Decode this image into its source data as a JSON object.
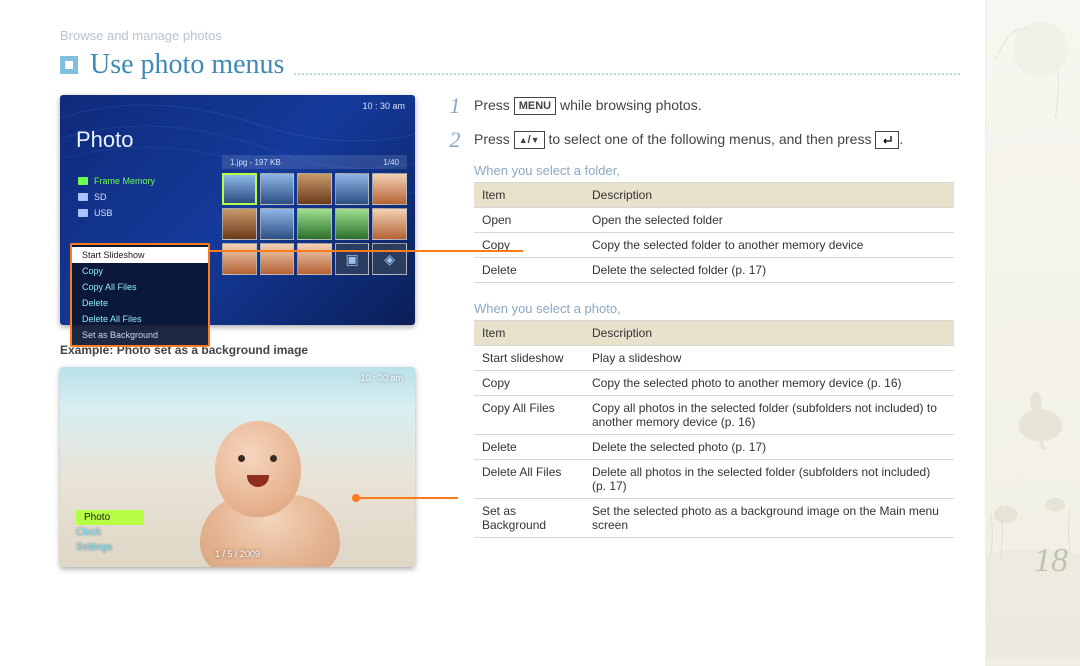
{
  "section_label": "Browse and manage photos",
  "page_title": "Use photo menus",
  "page_number": "18",
  "device1": {
    "clock": "10 : 30 am",
    "title": "Photo",
    "file_info": "1.jpg - 197 KB",
    "page_info": "1/40",
    "sources": {
      "frame": "Frame Memory",
      "sd": "SD",
      "usb": "USB"
    }
  },
  "context_menu": {
    "start_slideshow": "Start Slideshow",
    "copy": "Copy",
    "copy_all": "Copy All Files",
    "delete": "Delete",
    "delete_all": "Delete All Files",
    "set_bg": "Set as Background"
  },
  "example_caption": "Example: Photo set as a background image",
  "device2": {
    "clock": "10 : 30 am",
    "menu": {
      "photo": "Photo",
      "clock": "Clock",
      "settings": "Settings"
    },
    "pager": "1 / 5 / 2009"
  },
  "steps": {
    "s1_a": "Press ",
    "s1_key": "MENU",
    "s1_b": " while browsing photos.",
    "s2_a": "Press ",
    "s2_b": " to select one of the following menus, and then press ",
    "s2_c": "."
  },
  "folder_caption": "When you select a folder,",
  "folder_table": {
    "h1": "Item",
    "h2": "Description",
    "rows": [
      {
        "item": "Open",
        "desc": "Open the selected folder"
      },
      {
        "item": "Copy",
        "desc": "Copy the selected folder to another memory device"
      },
      {
        "item": "Delete",
        "desc": "Delete the selected folder (p. 17)"
      }
    ]
  },
  "photo_caption": "When you select a photo,",
  "photo_table": {
    "h1": "Item",
    "h2": "Description",
    "rows": [
      {
        "item": "Start slideshow",
        "desc": "Play a slideshow"
      },
      {
        "item": "Copy",
        "desc": "Copy the selected photo to another memory device (p. 16)"
      },
      {
        "item": "Copy All Files",
        "desc": "Copy all photos in the selected folder (subfolders not included) to another memory device (p. 16)"
      },
      {
        "item": "Delete",
        "desc": "Delete the selected photo (p. 17)"
      },
      {
        "item": "Delete All Files",
        "desc": "Delete all photos in the selected folder (subfolders not included) (p. 17)"
      },
      {
        "item": "Set as Background",
        "desc": "Set the selected photo as a background image on the Main menu screen"
      }
    ]
  }
}
